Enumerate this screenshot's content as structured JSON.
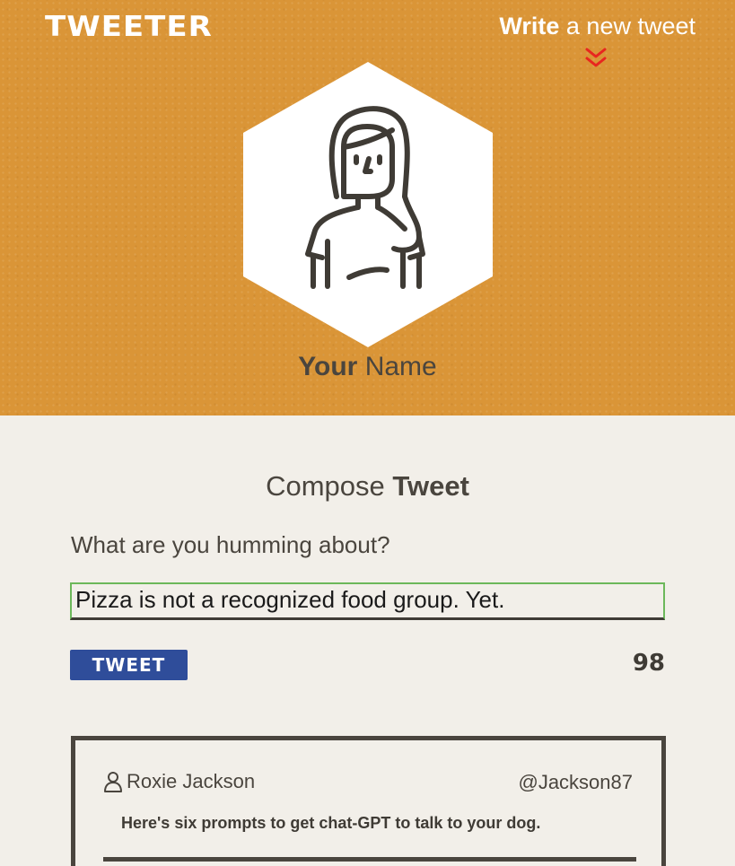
{
  "brand": {
    "logo": "TWEETER"
  },
  "nav": {
    "write_bold": "Write",
    "write_rest": "a new tweet",
    "arrow_icon": "double-chevron-down-icon",
    "arrow_color": "#e8261f"
  },
  "profile": {
    "name_bold": "Your",
    "name_rest": "Name",
    "avatar_icon": "woman-avatar-icon"
  },
  "compose": {
    "title_light": "Compose",
    "title_bold": "Tweet",
    "prompt": "What are you humming about?",
    "input_value": "Pizza is not a recognized food group. Yet.",
    "button_label": "TWEET",
    "counter": "98"
  },
  "tweets": [
    {
      "author_icon": "user-icon",
      "author": "Roxie Jackson",
      "handle": "@Jackson87",
      "content": "Here's six prompts to get chat-GPT to talk to your dog."
    }
  ],
  "colors": {
    "header_bg": "#da9537",
    "page_bg": "#f2efe9",
    "button_bg": "#2f4d9a",
    "text_dark": "#4a453e",
    "input_border": "#6cb85a"
  }
}
